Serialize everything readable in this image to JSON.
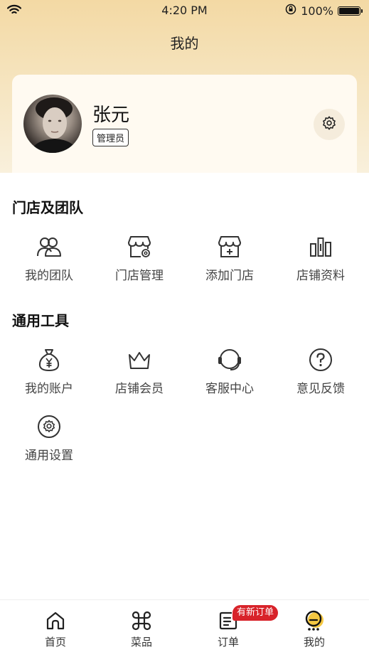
{
  "status_bar": {
    "time": "4:20 PM",
    "battery": "100%"
  },
  "nav": {
    "title": "我的"
  },
  "profile": {
    "name": "张元",
    "role": "管理员"
  },
  "sections": {
    "store_team": {
      "title": "门店及团队",
      "items": [
        {
          "label": "我的团队",
          "icon": "team-icon"
        },
        {
          "label": "门店管理",
          "icon": "store-manage-icon"
        },
        {
          "label": "添加门店",
          "icon": "add-store-icon"
        },
        {
          "label": "店铺资料",
          "icon": "store-data-icon"
        }
      ]
    },
    "tools": {
      "title": "通用工具",
      "items": [
        {
          "label": "我的账户",
          "icon": "money-bag-icon"
        },
        {
          "label": "店铺会员",
          "icon": "crown-icon"
        },
        {
          "label": "客服中心",
          "icon": "headset-icon"
        },
        {
          "label": "意见反馈",
          "icon": "question-icon"
        },
        {
          "label": "通用设置",
          "icon": "gear-icon"
        }
      ]
    }
  },
  "tabbar": {
    "tabs": [
      {
        "label": "首页",
        "icon": "home-icon"
      },
      {
        "label": "菜品",
        "icon": "dishes-icon"
      },
      {
        "label": "订单",
        "icon": "order-icon"
      },
      {
        "label": "我的",
        "icon": "profile-icon",
        "active": true
      }
    ],
    "order_badge": "有新订单"
  },
  "colors": {
    "header_gradient_top": "#f3d9a4",
    "header_gradient_bottom": "#f9f0dc",
    "badge_red": "#d8232a",
    "active_accent": "#f5c842"
  }
}
